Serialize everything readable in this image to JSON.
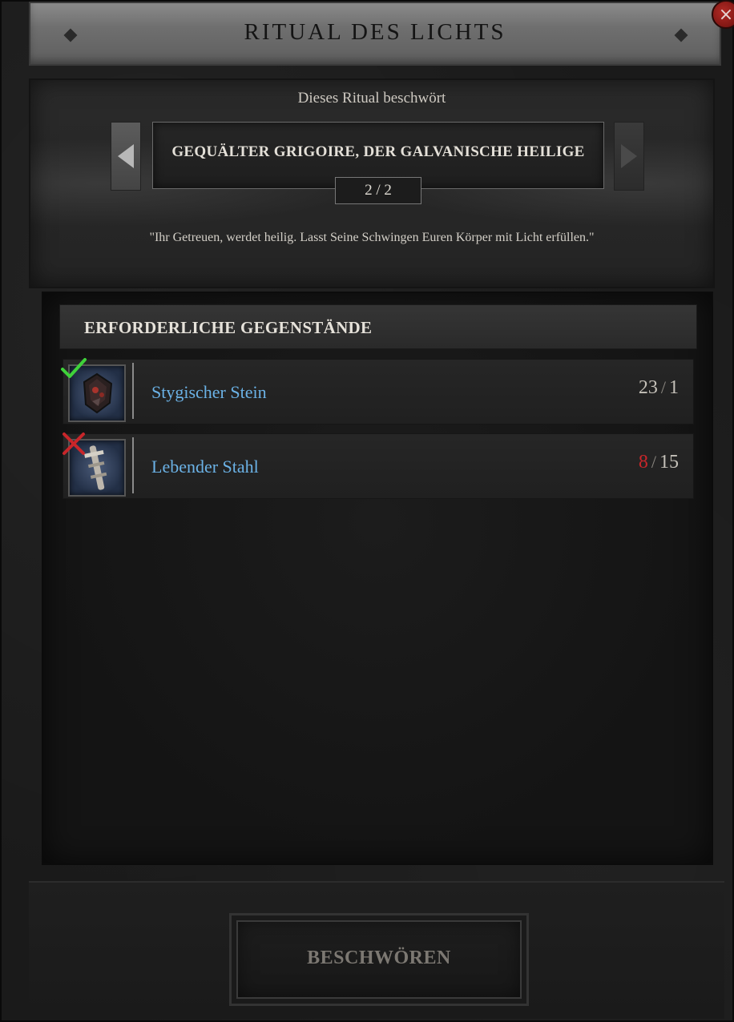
{
  "window": {
    "title": "RITUAL DES LICHTS",
    "close_label": "×"
  },
  "header": {
    "subtitle": "Dieses Ritual beschwört",
    "boss_name": "GEQUÄLTER GRIGOIRE, DER GALVANISCHE HEILIGE",
    "pager": "2 / 2",
    "quote": "\"Ihr Getreuen, werdet heilig. Lasst Seine Schwingen Euren Körper mit Licht erfüllen.\""
  },
  "requirements": {
    "section_title": "ERFORDERLICHE GEGENSTÄNDE",
    "items": [
      {
        "name": "Stygischer Stein",
        "have": "23",
        "need": "1",
        "status": "ok",
        "icon": "stygian-stone-icon"
      },
      {
        "name": "Lebender Stahl",
        "have": "8",
        "need": "15",
        "status": "missing",
        "icon": "living-steel-icon"
      }
    ]
  },
  "footer": {
    "summon_label": "BESCHWÖREN"
  },
  "colors": {
    "item_name": "#6bb2e6",
    "missing_count": "#c8262a",
    "check": "#3fd23a",
    "cross": "#c8262a"
  }
}
